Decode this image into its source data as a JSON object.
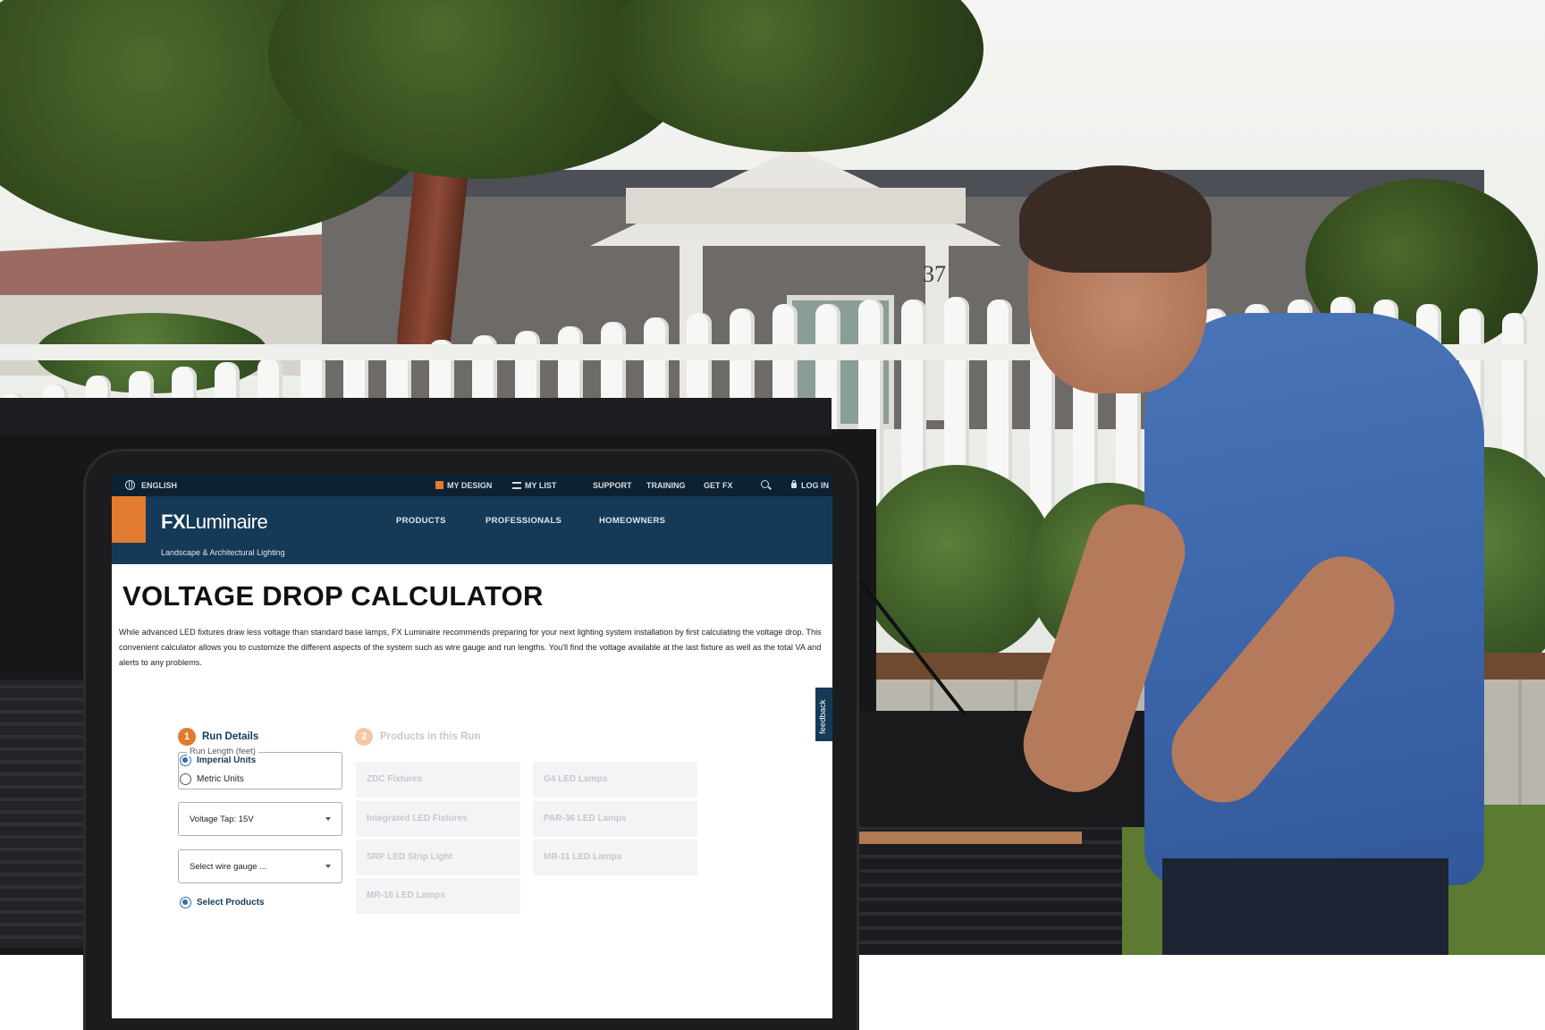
{
  "topbar": {
    "language": "ENGLISH",
    "my_design": "MY DESIGN",
    "my_list": "MY LIST",
    "support": "SUPPORT",
    "training": "TRAINING",
    "get_fx": "GET FX",
    "login": "LOG IN"
  },
  "header": {
    "logo_fx": "FX",
    "logo_name": "Luminaire",
    "tagline": "Landscape & Architectural Lighting",
    "nav": [
      "PRODUCTS",
      "PROFESSIONALS",
      "HOMEOWNERS"
    ]
  },
  "main": {
    "title": "VOLTAGE DROP CALCULATOR",
    "intro": "While advanced LED fixtures draw less voltage than standard base lamps, FX Luminaire recommends preparing for your next lighting system installation by first calculating the voltage drop. This convenient calculator allows you to customize the different aspects of the system such as wire gauge and run lengths. You'll find the voltage available at the last fixture as well as the total VA and alerts to any problems."
  },
  "run_details": {
    "step_number": "1",
    "title": "Run Details",
    "units": [
      {
        "label": "Imperial Units",
        "checked": true
      },
      {
        "label": "Metric Units",
        "checked": false
      }
    ],
    "run_length_label": "Run Length (feet)",
    "run_length_value": "",
    "voltage_tap": "Voltage Tap: 15V",
    "wire_gauge": "Select wire gauge ...",
    "select_products": "Select Products"
  },
  "products": {
    "step_number": "2",
    "title": "Products in this Run",
    "left": [
      "ZDC Fixtures",
      "Integrated LED Fixtures",
      "SRP LED Strip Light",
      "MR-16 LED Lamps"
    ],
    "right": [
      "G4 LED Lamps",
      "PAR-36 LED Lamps",
      "MR-11 LED Lamps"
    ]
  },
  "feedback": "feedback",
  "photo": {
    "house_number": "37"
  },
  "colors": {
    "navy": "#153a57",
    "topbar": "#0c2232",
    "accent_orange": "#e27b2f",
    "link_blue": "#2f6db5",
    "disabled_step": "#f4c8a6",
    "disabled_text": "#c4c9ce"
  }
}
